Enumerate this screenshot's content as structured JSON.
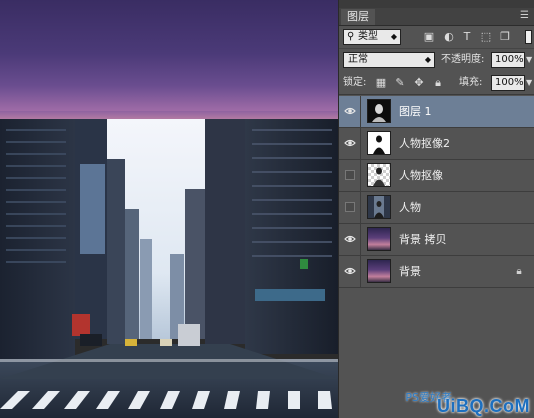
{
  "panel": {
    "tab_label": "图层",
    "menu_icon": "panel-menu-icon",
    "filter": {
      "kind_label": "类型",
      "icons": [
        "image-filter-icon",
        "adjustment-filter-icon",
        "type-filter-icon",
        "shape-filter-icon",
        "smart-object-filter-icon"
      ]
    },
    "blend_mode": "正常",
    "opacity_label": "不透明度:",
    "opacity_value": "100%",
    "lock_label": "锁定:",
    "lock_icons": [
      "lock-transparent-icon",
      "lock-paint-icon",
      "lock-move-icon",
      "lock-all-icon"
    ],
    "fill_label": "填充:",
    "fill_value": "100%"
  },
  "layers": [
    {
      "name": "图层 1",
      "visible": true,
      "selected": true,
      "thumb": "portrait-dark",
      "locked": false
    },
    {
      "name": "人物抠像2",
      "visible": true,
      "selected": false,
      "thumb": "silhouette",
      "locked": false
    },
    {
      "name": "人物抠像",
      "visible": false,
      "selected": false,
      "thumb": "cutout-transparent",
      "locked": false
    },
    {
      "name": "人物",
      "visible": false,
      "selected": false,
      "thumb": "person-photo",
      "locked": false
    },
    {
      "name": "背景 拷贝",
      "visible": true,
      "selected": false,
      "thumb": "sunset",
      "locked": false
    },
    {
      "name": "背景",
      "visible": true,
      "selected": false,
      "thumb": "sunset",
      "locked": true
    }
  ],
  "watermark": {
    "text": "UiBQ.CoM",
    "small": "PS爱好者"
  },
  "colors": {
    "panel_bg": "#535353",
    "selected_layer": "#6d7f96",
    "sky_purple": "#4b3a78",
    "watermark_blue": "#1d6fbf"
  }
}
